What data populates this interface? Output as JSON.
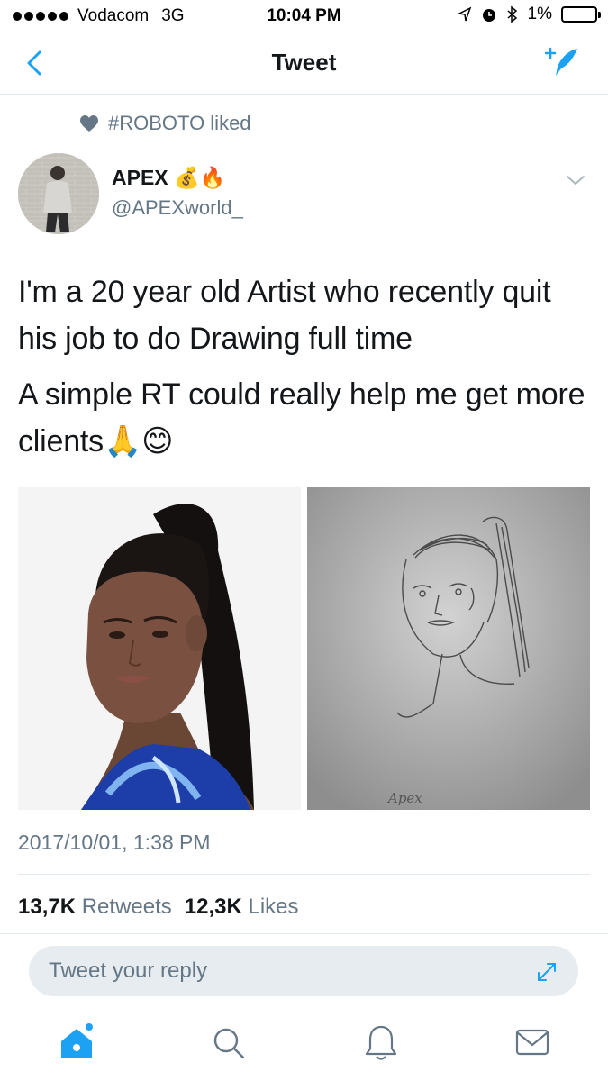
{
  "status_bar": {
    "carrier": "Vodacom",
    "network": "3G",
    "time": "10:04 PM",
    "battery": "1%",
    "icons": [
      "signal-dots-icon",
      "location-arrow-icon",
      "alarm-icon",
      "bluetooth-icon",
      "battery-icon"
    ]
  },
  "nav": {
    "title": "Tweet",
    "back_icon": "chevron-left-icon",
    "compose_icon": "compose-tweet-icon"
  },
  "social_context": {
    "text": "#ROBOTO liked",
    "icon": "heart-icon"
  },
  "author": {
    "name": "APEX 💰🔥",
    "handle": "@APEXworld_"
  },
  "tweet": {
    "paragraphs": [
      "I'm a 20 year old Artist who recently quit his job to do Drawing full time",
      "A simple RT could really help me get more clients🙏😊"
    ],
    "timestamp": "2017/10/01, 1:38 PM",
    "retweets_count": "13,7K",
    "retweets_label": "Retweets",
    "likes_count": "12,3K",
    "likes_label": "Likes"
  },
  "media": {
    "sketch_signature": "Apex"
  },
  "reply": {
    "placeholder": "Tweet your reply"
  },
  "tab_bar": {
    "items": [
      "home-icon",
      "search-icon",
      "notifications-icon",
      "messages-icon"
    ]
  },
  "colors": {
    "accent": "#1da1f2",
    "secondary_text": "#657786",
    "divider": "#e1e8ed"
  }
}
